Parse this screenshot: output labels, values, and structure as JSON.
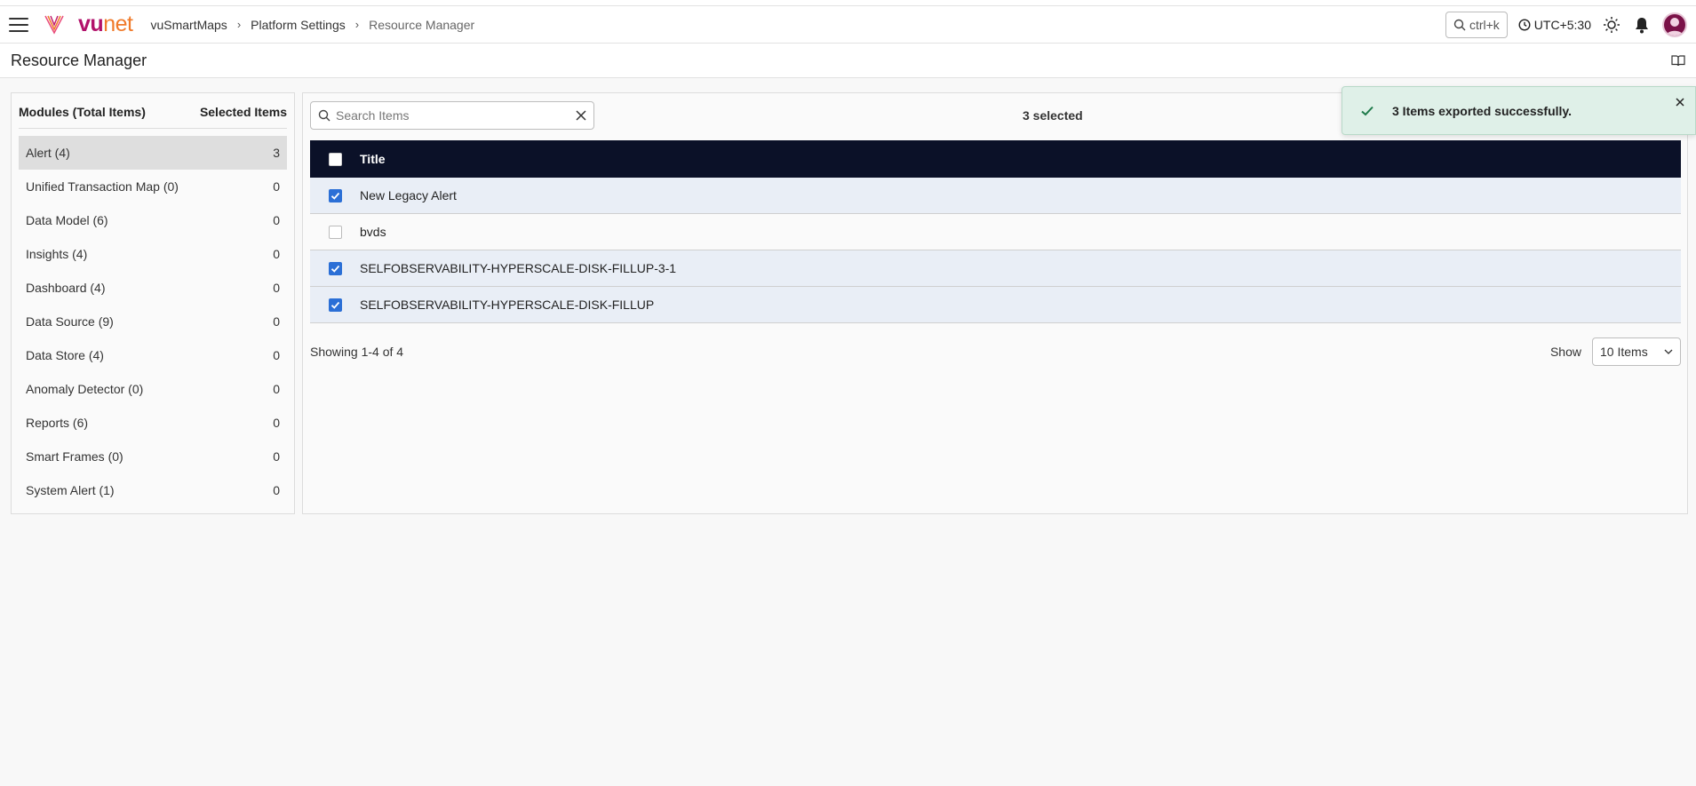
{
  "header": {
    "logo": {
      "vu": "vu",
      "net": "net"
    },
    "breadcrumb": [
      "vuSmartMaps",
      "Platform Settings",
      "Resource Manager"
    ],
    "search_shortcut": "ctrl+k",
    "timezone": "UTC+5:30"
  },
  "page": {
    "title": "Resource Manager"
  },
  "modules": {
    "header_left": "Modules (Total Items)",
    "header_right": "Selected Items",
    "items": [
      {
        "label": "Alert (4)",
        "count": "3"
      },
      {
        "label": "Unified Transaction Map (0)",
        "count": "0"
      },
      {
        "label": "Data Model (6)",
        "count": "0"
      },
      {
        "label": "Insights (4)",
        "count": "0"
      },
      {
        "label": "Dashboard (4)",
        "count": "0"
      },
      {
        "label": "Data Source (9)",
        "count": "0"
      },
      {
        "label": "Data Store (4)",
        "count": "0"
      },
      {
        "label": "Anomaly Detector (0)",
        "count": "0"
      },
      {
        "label": "Reports (6)",
        "count": "0"
      },
      {
        "label": "Smart Frames (0)",
        "count": "0"
      },
      {
        "label": "System Alert (1)",
        "count": "0"
      }
    ]
  },
  "items_panel": {
    "search_placeholder": "Search Items",
    "selected_text": "3 selected",
    "column_title": "Title",
    "rows": [
      {
        "title": "New Legacy Alert",
        "checked": true
      },
      {
        "title": "bvds",
        "checked": false
      },
      {
        "title": "SELFOBSERVABILITY-HYPERSCALE-DISK-FILLUP-3-1",
        "checked": true
      },
      {
        "title": "SELFOBSERVABILITY-HYPERSCALE-DISK-FILLUP",
        "checked": true
      }
    ],
    "showing": "Showing 1-4 of 4",
    "show_label": "Show",
    "page_size": "10 Items"
  },
  "toast": {
    "message": "3 Items exported successfully."
  },
  "colors": {
    "table_header": "#0b1128",
    "checkbox_accent": "#2b6fd6",
    "brand_magenta": "#b2126b",
    "brand_orange": "#f07a2a",
    "toast_bg": "#dff0e8",
    "success_check": "#1e7a4a"
  }
}
